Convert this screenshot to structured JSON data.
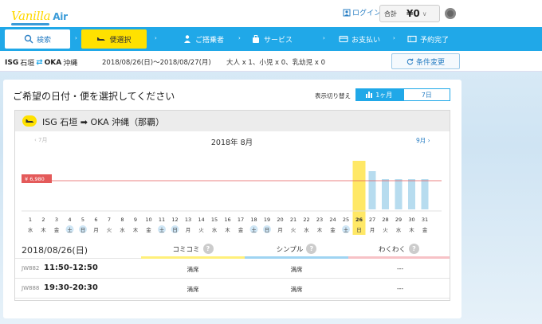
{
  "header": {
    "logo_main": "Vanilla",
    "logo_sub": "Air",
    "login_label": "ログイン",
    "total_label": "合計",
    "total_amount": "¥0",
    "total_chev": "∨"
  },
  "steps": [
    {
      "label": "検索",
      "icon": "search-icon"
    },
    {
      "label": "便選択",
      "icon": "plane-icon"
    },
    {
      "label": "ご搭乗者",
      "icon": "person-icon"
    },
    {
      "label": "サービス",
      "icon": "luggage-icon"
    },
    {
      "label": "お支払い",
      "icon": "card-icon"
    },
    {
      "label": "予約完了",
      "icon": "ticket-icon"
    }
  ],
  "step_arrow": "›",
  "conditions": {
    "origin_code": "ISG",
    "origin_name": "石垣",
    "route_icon": "⇄",
    "dest_code": "OKA",
    "dest_name": "沖縄",
    "dates": "2018/08/26(日)〜2018/08/27(月)",
    "pax": "大人 x 1、小児 x 0、乳幼児 x 0",
    "change_label": "条件変更",
    "change_icon": "refresh-icon"
  },
  "panel": {
    "title": "ご希望の日付・便を選択してください",
    "toggle_label": "表示切り替え",
    "toggle_month": "1ヶ月",
    "toggle_week": "7日"
  },
  "route_card": {
    "origin_code": "ISG",
    "origin_name": "石垣",
    "arrow": "➡",
    "dest_code": "OKA",
    "dest_name": "沖縄（那覇）"
  },
  "calendar": {
    "month_title": "2018年 8月",
    "prev_label": "7月",
    "next_label": "9月",
    "price_label": "¥ 6,980",
    "price_level": 6980,
    "selected_day": 26,
    "days": [
      {
        "d": "1",
        "w": "水",
        "hol": false,
        "bar": null
      },
      {
        "d": "2",
        "w": "木",
        "hol": false,
        "bar": null
      },
      {
        "d": "3",
        "w": "金",
        "hol": false,
        "bar": null
      },
      {
        "d": "4",
        "w": "土",
        "hol": true,
        "bar": null
      },
      {
        "d": "5",
        "w": "日",
        "hol": true,
        "bar": null
      },
      {
        "d": "6",
        "w": "月",
        "hol": false,
        "bar": null
      },
      {
        "d": "7",
        "w": "火",
        "hol": false,
        "bar": null
      },
      {
        "d": "8",
        "w": "水",
        "hol": false,
        "bar": null
      },
      {
        "d": "9",
        "w": "木",
        "hol": false,
        "bar": null
      },
      {
        "d": "10",
        "w": "金",
        "hol": false,
        "bar": null
      },
      {
        "d": "11",
        "w": "土",
        "hol": true,
        "bar": null
      },
      {
        "d": "12",
        "w": "日",
        "hol": true,
        "bar": null
      },
      {
        "d": "13",
        "w": "月",
        "hol": false,
        "bar": null
      },
      {
        "d": "14",
        "w": "火",
        "hol": false,
        "bar": null
      },
      {
        "d": "15",
        "w": "水",
        "hol": false,
        "bar": null
      },
      {
        "d": "16",
        "w": "木",
        "hol": false,
        "bar": null
      },
      {
        "d": "17",
        "w": "金",
        "hol": false,
        "bar": null
      },
      {
        "d": "18",
        "w": "土",
        "hol": true,
        "bar": null
      },
      {
        "d": "19",
        "w": "日",
        "hol": true,
        "bar": null
      },
      {
        "d": "20",
        "w": "月",
        "hol": false,
        "bar": null
      },
      {
        "d": "21",
        "w": "火",
        "hol": false,
        "bar": null
      },
      {
        "d": "22",
        "w": "水",
        "hol": false,
        "bar": null
      },
      {
        "d": "23",
        "w": "木",
        "hol": false,
        "bar": null
      },
      {
        "d": "24",
        "w": "金",
        "hol": false,
        "bar": null
      },
      {
        "d": "25",
        "w": "土",
        "hol": true,
        "bar": null
      },
      {
        "d": "26",
        "w": "日",
        "hol": true,
        "bar": "selected"
      },
      {
        "d": "27",
        "w": "月",
        "hol": false,
        "bar": "available"
      },
      {
        "d": "28",
        "w": "火",
        "hol": false,
        "bar": "available"
      },
      {
        "d": "29",
        "w": "水",
        "hol": false,
        "bar": "available"
      },
      {
        "d": "30",
        "w": "木",
        "hol": false,
        "bar": "available"
      },
      {
        "d": "31",
        "w": "金",
        "hol": false,
        "bar": "available"
      }
    ]
  },
  "flights": {
    "date_label": "2018/08/26(日)",
    "fare_types": [
      "コミコミ",
      "シンプル",
      "わくわく"
    ],
    "help_glyph": "?",
    "rows": [
      {
        "no": "JW882",
        "time": "11:50-12:50",
        "fares": [
          "満席",
          "満席",
          "---"
        ]
      },
      {
        "no": "JW888",
        "time": "19:30-20:30",
        "fares": [
          "満席",
          "満席",
          "---"
        ]
      }
    ]
  },
  "colors": {
    "brand_blue": "#20a8e8",
    "brand_yellow": "#ffe100",
    "bar_available": "#b7dcef",
    "bar_selected": "#ffe866",
    "price_line": "#e45a5a"
  }
}
